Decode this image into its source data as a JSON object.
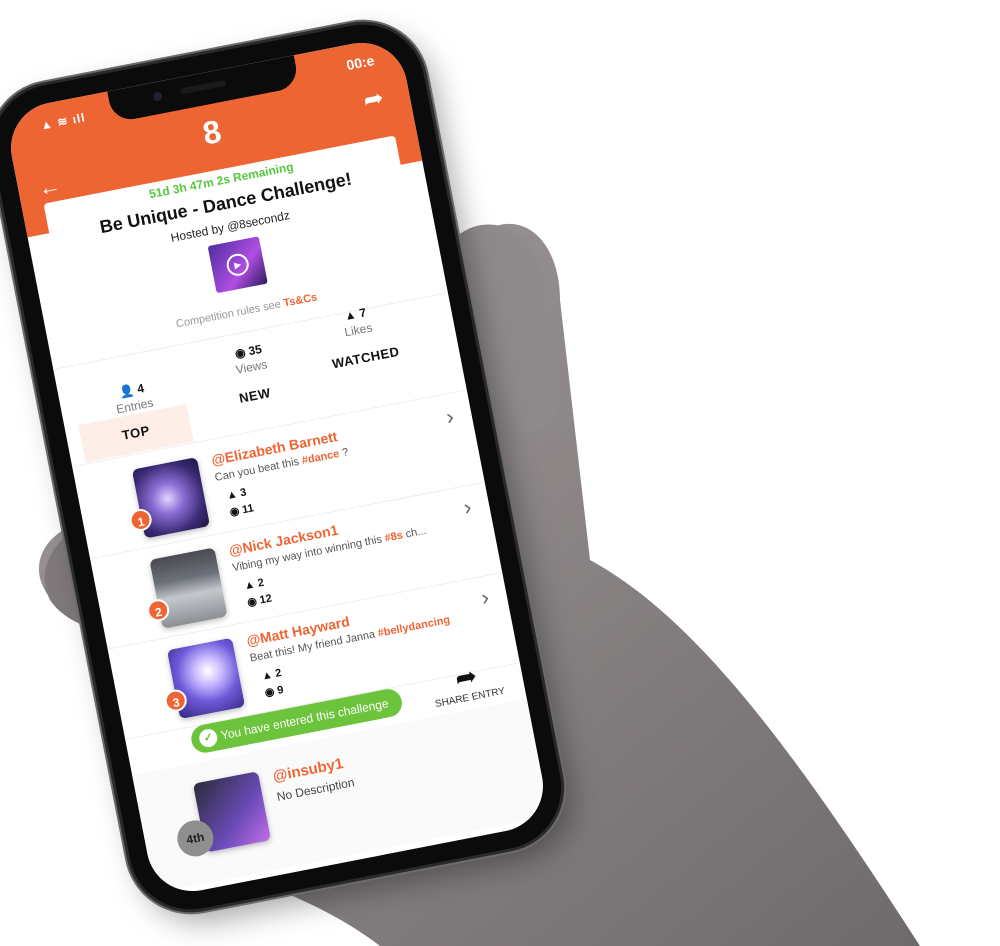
{
  "status_bar": {
    "signal_text": "▲ ≋ ıll",
    "time": "00:e"
  },
  "header": {
    "logo": "8",
    "remaining": "51d 3h 47m 2s Remaining",
    "title": "Be Unique - Dance Challenge!",
    "hosted_by": "Hosted by @8secondz",
    "rules_prefix": "Competition rules see",
    "rules_link": "Ts&Cs"
  },
  "stats": {
    "entries": {
      "value": "4",
      "label": "Entries"
    },
    "views": {
      "value": "35",
      "label": "Views"
    },
    "likes": {
      "value": "7",
      "label": "Likes"
    }
  },
  "tabs": [
    {
      "label": "TOP",
      "active": true
    },
    {
      "label": "NEW",
      "active": false
    },
    {
      "label": "WATCHED",
      "active": false
    }
  ],
  "entries": [
    {
      "rank": "1",
      "user": "@Elizabeth Barnett",
      "desc_text": "Can you beat this",
      "desc_tag": "#dance",
      "desc_tail": " ?",
      "likes": "3",
      "views": "11"
    },
    {
      "rank": "2",
      "user": "@Nick Jackson1",
      "desc_text": "Vibing my way into winning this",
      "desc_tag": "#8s",
      "desc_tail": " ch...",
      "likes": "2",
      "views": "12"
    },
    {
      "rank": "3",
      "user": "@Matt Hayward",
      "desc_text": "Beat this! My friend Janna",
      "desc_tag": "#bellydancing",
      "desc_tail": "",
      "likes": "2",
      "views": "9"
    }
  ],
  "entered_banner": "You have entered this challenge",
  "share_entry": "SHARE ENTRY",
  "my_entry": {
    "rank": "4th",
    "user": "@insuby1",
    "desc": "No Description"
  },
  "colors": {
    "brand": "#ee6534",
    "success": "#6cc33c",
    "timer": "#55c73d"
  }
}
